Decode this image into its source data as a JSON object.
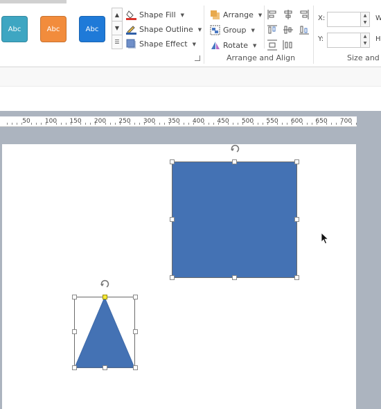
{
  "shape_styles": {
    "swatches": [
      {
        "label": "Abc",
        "color": "#3ea6c2"
      },
      {
        "label": "Abc",
        "color": "#f28c3c"
      },
      {
        "label": "Abc",
        "color": "#1f7ad8"
      }
    ],
    "shape_fill": "Shape Fill",
    "shape_outline": "Shape Outline",
    "shape_effect": "Shape Effect"
  },
  "arrange": {
    "arrange": "Arrange",
    "group": "Group",
    "rotate": "Rotate",
    "group_label": "Arrange and Align"
  },
  "size": {
    "x_label": "X:",
    "y_label": "Y:",
    "x_value": "",
    "y_value": "",
    "w_label": "W",
    "h_label": "H",
    "group_label": "Size and"
  },
  "ruler": {
    "labels": [
      "50",
      "100",
      "150",
      "200",
      "250",
      "300",
      "350",
      "400",
      "450",
      "500",
      "550",
      "600",
      "650",
      "700"
    ]
  },
  "canvas": {
    "shape_color": "#4472b4",
    "shapes": [
      "rectangle",
      "triangle"
    ]
  }
}
